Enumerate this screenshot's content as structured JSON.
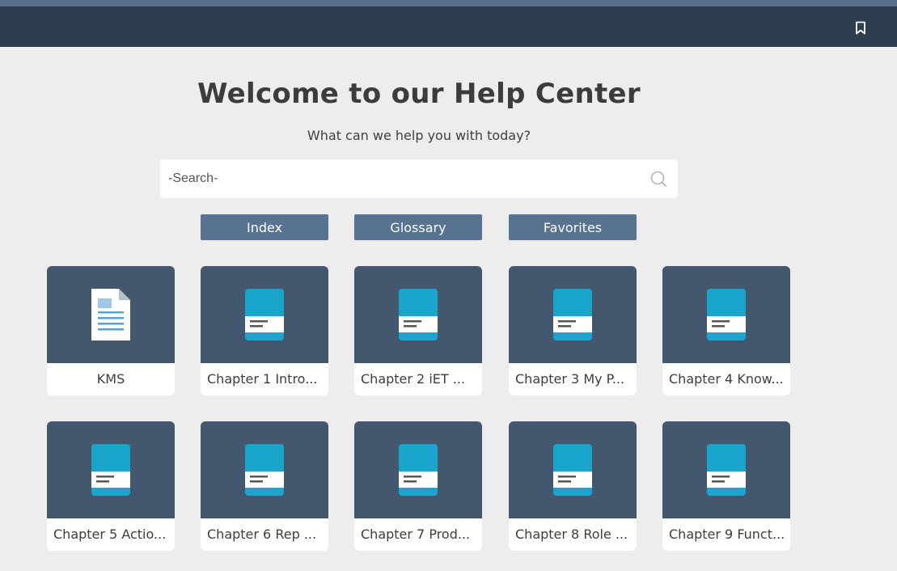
{
  "header": {
    "bookmark_icon": "bookmark-icon"
  },
  "hero": {
    "title": "Welcome to our Help Center",
    "subtitle": "What can we help you with today?"
  },
  "search": {
    "placeholder": "-Search-",
    "value": "",
    "icon": "search-icon"
  },
  "nav": {
    "index_label": "Index",
    "glossary_label": "Glossary",
    "favorites_label": "Favorites"
  },
  "cards": [
    {
      "label": "KMS",
      "icon": "document-icon"
    },
    {
      "label": "Chapter 1 Intro...",
      "icon": "book-icon"
    },
    {
      "label": "Chapter 2 iET ...",
      "icon": "book-icon"
    },
    {
      "label": "Chapter 3 My P...",
      "icon": "book-icon"
    },
    {
      "label": "Chapter 4 Know...",
      "icon": "book-icon"
    },
    {
      "label": "Chapter 5 Actio...",
      "icon": "book-icon"
    },
    {
      "label": "Chapter 6 Rep ...",
      "icon": "book-icon"
    },
    {
      "label": "Chapter 7 Prod...",
      "icon": "book-icon"
    },
    {
      "label": "Chapter 8 Role ...",
      "icon": "book-icon"
    },
    {
      "label": "Chapter 9 Funct...",
      "icon": "book-icon"
    }
  ],
  "colors": {
    "topbar": "#2f3e4f",
    "accent_strip": "#577089",
    "nav_button": "#587391",
    "card_thumb": "#43586e",
    "book_cyan": "#1aa6cc"
  }
}
